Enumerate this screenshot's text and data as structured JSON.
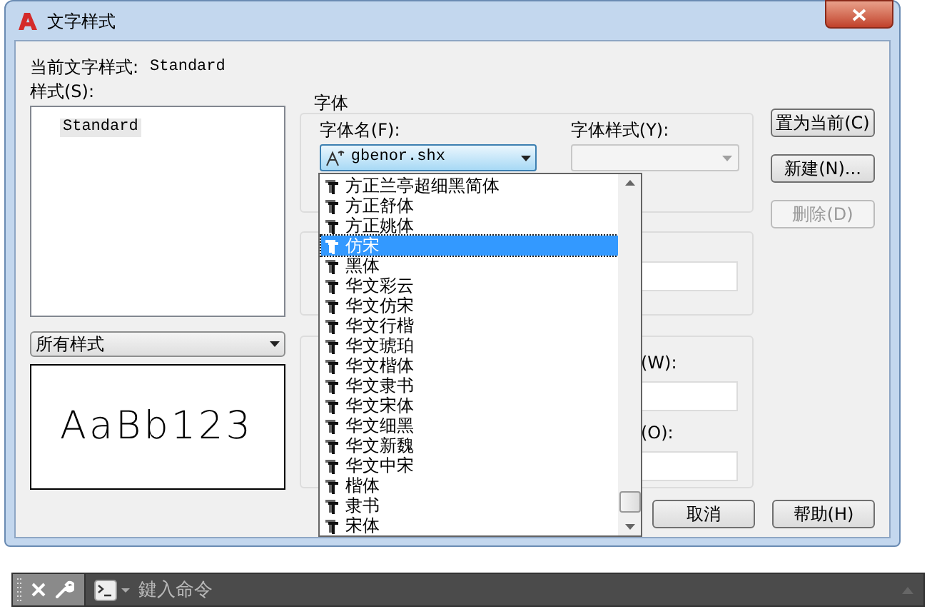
{
  "window": {
    "title": "文字样式"
  },
  "current_style": {
    "label": "当前文字样式:",
    "value": "Standard"
  },
  "styles": {
    "label": "样式(S):",
    "items": [
      {
        "label": "Standard",
        "selected": true
      }
    ]
  },
  "style_filter": {
    "value": "所有样式"
  },
  "preview": {
    "text": "AaBb123"
  },
  "font_group": {
    "title": "字体",
    "font_name": {
      "label": "字体名(F):",
      "value": "gbenor.shx",
      "expanded": true,
      "options": [
        {
          "label": "方正兰亭超细黑简体",
          "selected": false
        },
        {
          "label": "方正舒体",
          "selected": false
        },
        {
          "label": "方正姚体",
          "selected": false
        },
        {
          "label": "仿宋",
          "selected": true
        },
        {
          "label": "黑体",
          "selected": false
        },
        {
          "label": "华文彩云",
          "selected": false
        },
        {
          "label": "华文仿宋",
          "selected": false
        },
        {
          "label": "华文行楷",
          "selected": false
        },
        {
          "label": "华文琥珀",
          "selected": false
        },
        {
          "label": "华文楷体",
          "selected": false
        },
        {
          "label": "华文隶书",
          "selected": false
        },
        {
          "label": "华文宋体",
          "selected": false
        },
        {
          "label": "华文细黑",
          "selected": false
        },
        {
          "label": "华文新魏",
          "selected": false
        },
        {
          "label": "华文中宋",
          "selected": false
        },
        {
          "label": "楷体",
          "selected": false
        },
        {
          "label": "隶书",
          "selected": false
        },
        {
          "label": "宋体",
          "selected": false
        }
      ]
    },
    "font_style": {
      "label": "字体样式(Y):",
      "disabled": true
    }
  },
  "effects_group": {
    "width_label": "(W):",
    "oblique_label": "(O):"
  },
  "side_buttons": [
    {
      "label": "置为当前(C)",
      "disabled": false
    },
    {
      "label": "新建(N)...",
      "disabled": false
    },
    {
      "label": "删除(D)",
      "disabled": true
    }
  ],
  "bottom_buttons": [
    {
      "label": "取消"
    },
    {
      "label": "帮助(H)"
    }
  ],
  "command_line": {
    "placeholder": "鍵入命令"
  }
}
